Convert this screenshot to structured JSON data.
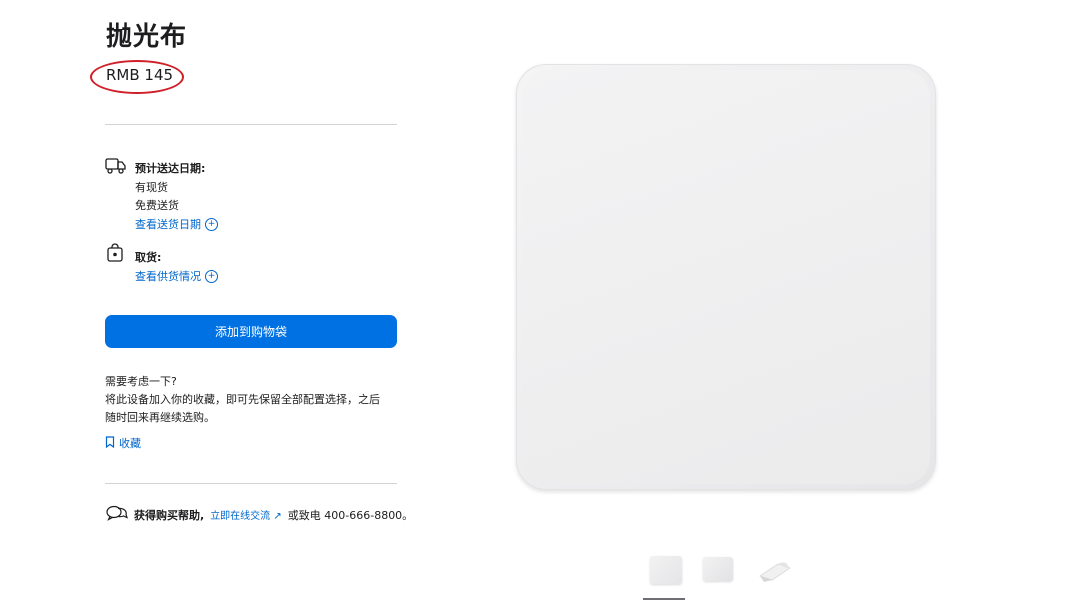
{
  "product": {
    "title": "抛光布",
    "price": "RMB 145"
  },
  "delivery": {
    "icon": "truck-icon",
    "label": "预计送达日期:",
    "lines": [
      "有现货",
      "免费送货"
    ],
    "link": "查看送货日期"
  },
  "pickup": {
    "icon": "bag-icon",
    "label": "取货:",
    "link": "查看供货情况"
  },
  "cta": {
    "add_to_bag": "添加到购物袋"
  },
  "save": {
    "heading": "需要考虑一下?",
    "desc1": "将此设备加入你的收藏，即可先保留全部配置选择，之后",
    "desc2": "随时回来再继续选购。",
    "link": "收藏",
    "icon": "bookmark-icon"
  },
  "help": {
    "icon": "chat-icon",
    "label": "获得购买帮助,",
    "link": "立即在线交流",
    "arrow": "↗",
    "tail": "或致电 400-666-8800。"
  },
  "gallery": {
    "thumbnails": [
      "thumbnail-front",
      "thumbnail-angle",
      "thumbnail-folded"
    ],
    "selected_index": 0
  },
  "colors": {
    "accent": "#0071e3",
    "link": "#0066cc",
    "annotation": "#d01f27"
  }
}
